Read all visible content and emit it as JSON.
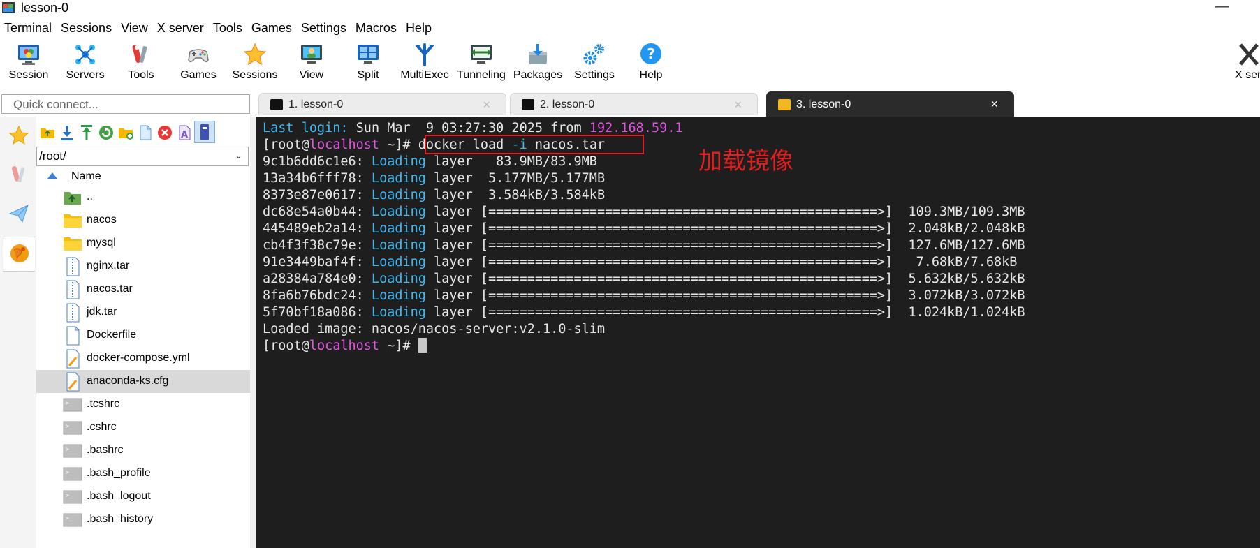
{
  "window": {
    "title": "lesson-0",
    "minimize_glyph": "—"
  },
  "menu": [
    "Terminal",
    "Sessions",
    "View",
    "X server",
    "Tools",
    "Games",
    "Settings",
    "Macros",
    "Help"
  ],
  "toolbar": [
    {
      "label": "Session",
      "icon": "session-icon"
    },
    {
      "label": "Servers",
      "icon": "servers-icon"
    },
    {
      "label": "Tools",
      "icon": "tools-icon"
    },
    {
      "label": "Games",
      "icon": "games-icon"
    },
    {
      "label": "Sessions",
      "icon": "star-icon"
    },
    {
      "label": "View",
      "icon": "view-icon"
    },
    {
      "label": "Split",
      "icon": "split-icon"
    },
    {
      "label": "MultiExec",
      "icon": "multiexec-icon"
    },
    {
      "label": "Tunneling",
      "icon": "tunneling-icon"
    },
    {
      "label": "Packages",
      "icon": "packages-icon"
    },
    {
      "label": "Settings",
      "icon": "settings-icon"
    },
    {
      "label": "Help",
      "icon": "help-icon"
    },
    {
      "label": "X ser",
      "icon": "xserver-icon"
    }
  ],
  "quick_connect": {
    "placeholder": "Quick connect..."
  },
  "tabs": [
    {
      "label": "1. lesson-0",
      "active": false
    },
    {
      "label": "2. lesson-0",
      "active": false
    },
    {
      "label": "3. lesson-0",
      "active": true
    }
  ],
  "tab_close_glyph": "×",
  "file_browser": {
    "path": "/root/",
    "path_chevron": "⌄",
    "column_header": "Name",
    "files": [
      {
        "name": "..",
        "type": "parent"
      },
      {
        "name": "nacos",
        "type": "folder"
      },
      {
        "name": "mysql",
        "type": "folder"
      },
      {
        "name": "nginx.tar",
        "type": "archive"
      },
      {
        "name": "nacos.tar",
        "type": "archive"
      },
      {
        "name": "jdk.tar",
        "type": "archive"
      },
      {
        "name": "Dockerfile",
        "type": "file"
      },
      {
        "name": "docker-compose.yml",
        "type": "edit"
      },
      {
        "name": "anaconda-ks.cfg",
        "type": "edit",
        "selected": true
      },
      {
        "name": ".tcshrc",
        "type": "script"
      },
      {
        "name": ".cshrc",
        "type": "script"
      },
      {
        "name": ".bashrc",
        "type": "script"
      },
      {
        "name": ".bash_profile",
        "type": "script"
      },
      {
        "name": ".bash_logout",
        "type": "script"
      },
      {
        "name": ".bash_history",
        "type": "script"
      }
    ]
  },
  "terminal": {
    "login": {
      "label": "Last login:",
      "datetime": " Sun Mar  9 03:27:30 2025 ",
      "from": "from",
      "ip": " 192.168.59.1"
    },
    "prompt": {
      "open": "[root@",
      "host": "localhost",
      "close": " ~]# "
    },
    "command": {
      "a": "docker load ",
      "flag": "-i",
      "b": " nacos.tar"
    },
    "annotation": "加载镜像",
    "layers": [
      {
        "id": "9c1b6dd6c1e6:",
        "status": " Loading",
        "rest": " layer   83.9MB/83.9MB"
      },
      {
        "id": "13a34b6fff78:",
        "status": " Loading",
        "rest": " layer  5.177MB/5.177MB"
      },
      {
        "id": "8373e87e0617:",
        "status": " Loading",
        "rest": " layer  3.584kB/3.584kB"
      },
      {
        "id": "dc68e54a0b44:",
        "status": " Loading",
        "rest": " layer [==================================================>]  109.3MB/109.3MB"
      },
      {
        "id": "445489eb2a14:",
        "status": " Loading",
        "rest": " layer [==================================================>]  2.048kB/2.048kB"
      },
      {
        "id": "cb4f3f38c79e:",
        "status": " Loading",
        "rest": " layer [==================================================>]  127.6MB/127.6MB"
      },
      {
        "id": "91e3449baf4f:",
        "status": " Loading",
        "rest": " layer [==================================================>]   7.68kB/7.68kB"
      },
      {
        "id": "a28384a784e0:",
        "status": " Loading",
        "rest": " layer [==================================================>]  5.632kB/5.632kB"
      },
      {
        "id": "8fa6b76bdc24:",
        "status": " Loading",
        "rest": " layer [==================================================>]  3.072kB/3.072kB"
      },
      {
        "id": "5f70bf18a086:",
        "status": " Loading",
        "rest": " layer [==================================================>]  1.024kB/1.024kB"
      }
    ],
    "loaded": "Loaded image: nacos/nacos-server:v2.1.0-slim"
  },
  "colors": {
    "terminal_bg": "#1e1e1e",
    "cyan": "#3fb8f0",
    "magenta": "#e055e0",
    "annotation_red": "#e02020"
  }
}
